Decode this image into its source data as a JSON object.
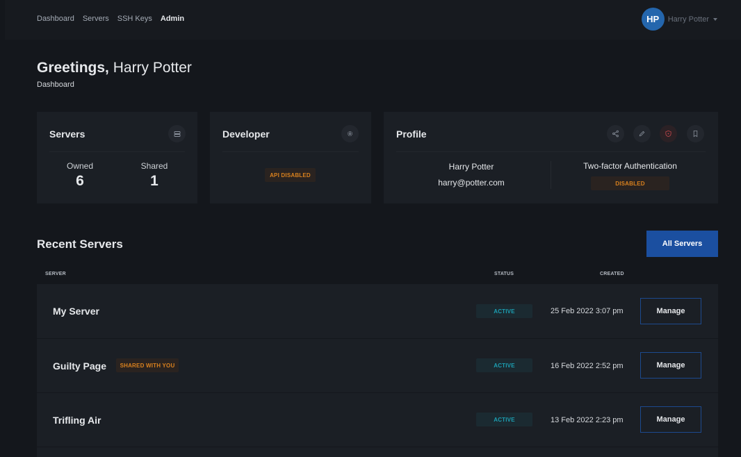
{
  "nav": {
    "links": [
      "Dashboard",
      "Servers",
      "SSH Keys",
      "Admin"
    ],
    "active": "Admin"
  },
  "user": {
    "initials": "HP",
    "name": "Harry Potter",
    "email": "harry@potter.com"
  },
  "greeting": {
    "bold": "Greetings,",
    "name": "Harry Potter",
    "subtitle": "Dashboard"
  },
  "cards": {
    "servers": {
      "title": "Servers",
      "icon": "server-icon",
      "owned_label": "Owned",
      "owned_value": "6",
      "shared_label": "Shared",
      "shared_value": "1"
    },
    "developer": {
      "title": "Developer",
      "icon": "gear-icon",
      "badge": "API DISABLED"
    },
    "profile": {
      "title": "Profile",
      "icons": [
        "share-icon",
        "edit-icon",
        "shield-icon",
        "bookmark-icon"
      ],
      "name": "Harry Potter",
      "email": "harry@potter.com",
      "twofa_label": "Two-factor Authentication",
      "twofa_badge": "DISABLED"
    }
  },
  "recent": {
    "title": "Recent Servers",
    "all_button": "All Servers",
    "columns": {
      "server": "SERVER",
      "status": "STATUS",
      "created": "CREATED"
    },
    "rows": [
      {
        "name": "My Server",
        "shared_badge": "",
        "status": "ACTIVE",
        "created": "25 Feb 2022 3:07 pm",
        "action": "Manage"
      },
      {
        "name": "Guilty Page",
        "shared_badge": "SHARED WITH YOU",
        "status": "ACTIVE",
        "created": "16 Feb 2022 2:52 pm",
        "action": "Manage"
      },
      {
        "name": "Trifling Air",
        "shared_badge": "",
        "status": "ACTIVE",
        "created": "13 Feb 2022 2:23 pm",
        "action": "Manage"
      }
    ]
  },
  "colors": {
    "accent": "#1b4fa0",
    "avatar": "#2466ad",
    "warning": "#d9811e",
    "active": "#1c9fb2",
    "danger": "#c0454b"
  }
}
